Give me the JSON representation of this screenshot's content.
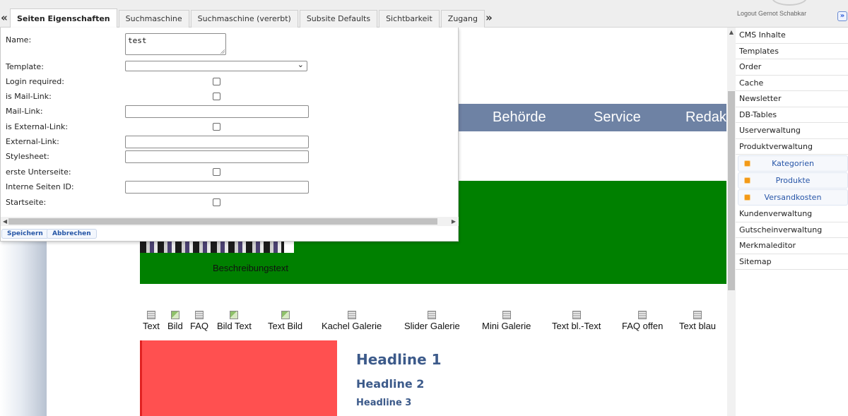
{
  "tabs": {
    "left_arrow": "«",
    "right_arrow": "»",
    "items": [
      {
        "label": "Seiten Eigenschaften"
      },
      {
        "label": "Suchmaschine"
      },
      {
        "label": "Suchmaschine (vererbt)"
      },
      {
        "label": "Subsite Defaults"
      },
      {
        "label": "Sichtbarkeit"
      },
      {
        "label": "Zugang"
      }
    ]
  },
  "header": {
    "logout_text": "Logout Gernot Schabkar",
    "collapse_glyph": "»"
  },
  "form": {
    "name_label": "Name:",
    "name_value": "test",
    "template_label": "Template:",
    "template_value": "",
    "login_required_label": "Login required:",
    "login_required_checked": false,
    "is_mail_link_label": "is Mail-Link:",
    "is_mail_link_checked": false,
    "mail_link_label": "Mail-Link:",
    "mail_link_value": "",
    "is_external_link_label": "is External-Link:",
    "is_external_link_checked": false,
    "external_link_label": "External-Link:",
    "external_link_value": "",
    "stylesheet_label": "Stylesheet:",
    "stylesheet_value": "",
    "erste_unterseite_label": "erste Unterseite:",
    "erste_unterseite_checked": false,
    "interne_seiten_id_label": "Interne Seiten ID:",
    "interne_seiten_id_value": "",
    "startseite_label": "Startseite:",
    "startseite_checked": false
  },
  "buttons": {
    "save_label": "Speichern",
    "cancel_label": "Abbrechen"
  },
  "preview": {
    "nav_items": [
      "Behörde",
      "Service",
      "Redakt"
    ],
    "description": "Beschreibungstext",
    "widgets": [
      {
        "label": "Text",
        "icon": "text-widget-icon"
      },
      {
        "label": "Bild",
        "icon": "image-widget-icon"
      },
      {
        "label": "FAQ",
        "icon": "faq-widget-icon"
      },
      {
        "label": "Bild Text",
        "icon": "image-text-widget-icon"
      },
      {
        "label": "Text Bild",
        "icon": "text-image-widget-icon"
      },
      {
        "label": "Kachel Galerie",
        "icon": "tile-gallery-widget-icon"
      },
      {
        "label": "Slider Galerie",
        "icon": "slider-gallery-widget-icon"
      },
      {
        "label": "Mini Galerie",
        "icon": "mini-gallery-widget-icon"
      },
      {
        "label": "Text bl.-Text",
        "icon": "text-block-text-widget-icon"
      },
      {
        "label": "FAQ offen",
        "icon": "faq-open-widget-icon"
      },
      {
        "label": "Text blau",
        "icon": "text-blue-widget-icon"
      }
    ],
    "headline1": "Headline 1",
    "headline2": "Headline 2",
    "headline3": "Headline 3",
    "colors": {
      "nav": "#6e82a4",
      "green": "#008000",
      "red": "#ff5050",
      "headline": "#3c5a8a"
    }
  },
  "sidebar": {
    "items": [
      {
        "label": "CMS Inhalte"
      },
      {
        "label": "Templates"
      },
      {
        "label": "Order"
      },
      {
        "label": "Cache"
      },
      {
        "label": "Newsletter"
      },
      {
        "label": "DB-Tables"
      },
      {
        "label": "Userverwaltung"
      },
      {
        "label": "Produktverwaltung"
      }
    ],
    "subitems": [
      {
        "label": "Kategorien"
      },
      {
        "label": "Produkte"
      },
      {
        "label": "Versandkosten"
      }
    ],
    "items_after": [
      {
        "label": "Kundenverwaltung"
      },
      {
        "label": "Gutscheinverwaltung"
      },
      {
        "label": "Merkmaleditor"
      },
      {
        "label": "Sitemap"
      }
    ]
  }
}
